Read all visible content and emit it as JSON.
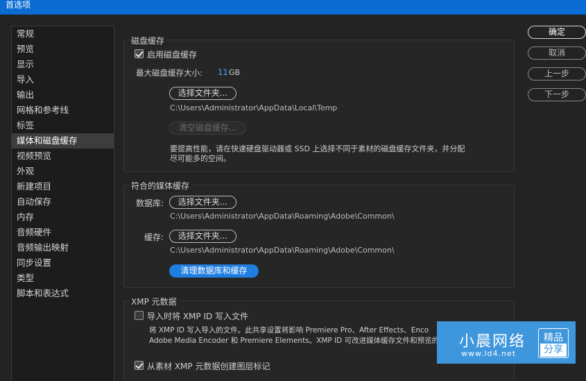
{
  "window": {
    "title": "首选项"
  },
  "sidebar": {
    "items": [
      {
        "label": "常规"
      },
      {
        "label": "预览"
      },
      {
        "label": "显示"
      },
      {
        "label": "导入"
      },
      {
        "label": "输出"
      },
      {
        "label": "网格和参考线"
      },
      {
        "label": "标签"
      },
      {
        "label": "媒体和磁盘缓存",
        "selected": true
      },
      {
        "label": "视频预览"
      },
      {
        "label": "外观"
      },
      {
        "label": "新建项目"
      },
      {
        "label": "自动保存"
      },
      {
        "label": "内存"
      },
      {
        "label": "音频硬件"
      },
      {
        "label": "音频输出映射"
      },
      {
        "label": "同步设置"
      },
      {
        "label": "类型"
      },
      {
        "label": "脚本和表达式"
      }
    ]
  },
  "disk_cache": {
    "title": "磁盘缓存",
    "enable_label": "启用磁盘缓存",
    "enable_checked": true,
    "max_size_label": "最大磁盘缓存大小:",
    "max_size_value": "11",
    "max_size_unit": "GB",
    "choose_folder_label": "选择文件夹...",
    "path": "C:\\Users\\Administrator\\AppData\\Local\\Temp",
    "empty_cache_label": "清空磁盘缓存...",
    "hint_line1": "要提高性能，请在快速硬盘驱动器或 SSD 上选择不同于素材的磁盘缓存文件夹，并分配",
    "hint_line2": "尽可能多的空间。"
  },
  "media_cache": {
    "title": "符合的媒体缓存",
    "db_label": "数据库:",
    "db_button": "选择文件夹...",
    "db_path": "C:\\Users\\Administrator\\AppData\\Roaming\\Adobe\\Common\\",
    "cache_label": "缓存:",
    "cache_button": "选择文件夹...",
    "cache_path": "C:\\Users\\Administrator\\AppData\\Roaming\\Adobe\\Common\\",
    "clean_button": "清理数据库和缓存"
  },
  "xmp": {
    "title": "XMP 元数据",
    "write_id_label": "导入时将 XMP ID 写入文件",
    "write_id_checked": false,
    "desc_line1": "将 XMP ID 写入导入的文件。此共享设置将影响 Premiere Pro、After  Effects、Enco",
    "desc_line2": "Adobe Media Encoder 和 Premiere  Elements。XMP ID 可改进媒体缓存文件和预览的共",
    "create_markers_label": "从素材 XMP 元数据创建图层标记",
    "create_markers_checked": true
  },
  "buttons": {
    "ok": "确定",
    "cancel": "取消",
    "prev": "上一步",
    "next": "下一步"
  },
  "watermark": {
    "title": "小晨网络",
    "url": "www.ld4.net",
    "badge_top": "精品",
    "badge_bottom": "分享"
  },
  "colors": {
    "title_bar": "#0a6bd2",
    "accent": "#1f7ee0",
    "background": "#232323",
    "watermark": "#3e96dd"
  }
}
